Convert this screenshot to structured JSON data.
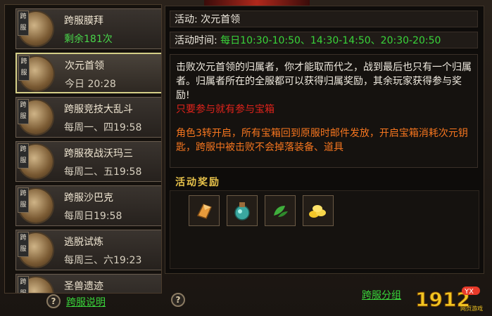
{
  "activities": [
    {
      "title": "跨服膜拜",
      "sub": "剩余181次",
      "sub_green": true,
      "badge_tag": "跨服"
    },
    {
      "title": "次元首领",
      "sub": "今日 20:28",
      "sub_green": false,
      "badge_tag": "跨服",
      "selected": true
    },
    {
      "title": "跨服竞技大乱斗",
      "sub": "每周一、四19:58",
      "sub_green": false,
      "badge_tag": "跨服"
    },
    {
      "title": "跨服夜战沃玛三",
      "sub": "每周二、五19:58",
      "sub_green": false,
      "badge_tag": "跨服"
    },
    {
      "title": "跨服沙巴克",
      "sub": "每周日19:58",
      "sub_green": false,
      "badge_tag": "跨服"
    },
    {
      "title": "逃脱试炼",
      "sub": "每周三、六19:23",
      "sub_green": false,
      "badge_tag": "跨服"
    },
    {
      "title": "圣兽遗迹",
      "sub": "",
      "sub_green": false,
      "badge_tag": "跨服"
    }
  ],
  "left_help_label": "跨服说明",
  "detail": {
    "activity_label": "活动:",
    "activity_name": "次元首领",
    "time_label": "活动时间:",
    "time_value": "每日10:30-10:50、14:30-14:50、20:30-20:50",
    "desc_main": "击败次元首领的归属者，你才能取而代之，战到最后也只有一个归属者。归属者所在的全服都可以获得归属奖励，其余玩家获得参与奖励!",
    "desc_red": "只要参与就有参与宝箱",
    "desc_orange": "角色3转开启，所有宝箱回到原服时邮件发放，开启宝箱消耗次元钥匙，跨服中被击败不会掉落装备、道具",
    "reward_header": "活动奖励",
    "rewards": [
      "crystal-shard-icon",
      "potion-flask-icon",
      "green-leaves-icon",
      "gold-coins-icon"
    ]
  },
  "help_symbol": "?",
  "group_link": "跨服分组",
  "logo_text": "1912",
  "logo_badge": "YX",
  "logo_sub": "网页游戏"
}
